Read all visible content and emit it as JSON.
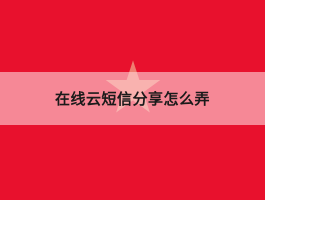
{
  "banner": {
    "title": "在线云短信分享怎么弄",
    "background_color": "#e8112d",
    "overlay_color": "#ffd2d7",
    "watermark_icon": "star-icon"
  }
}
